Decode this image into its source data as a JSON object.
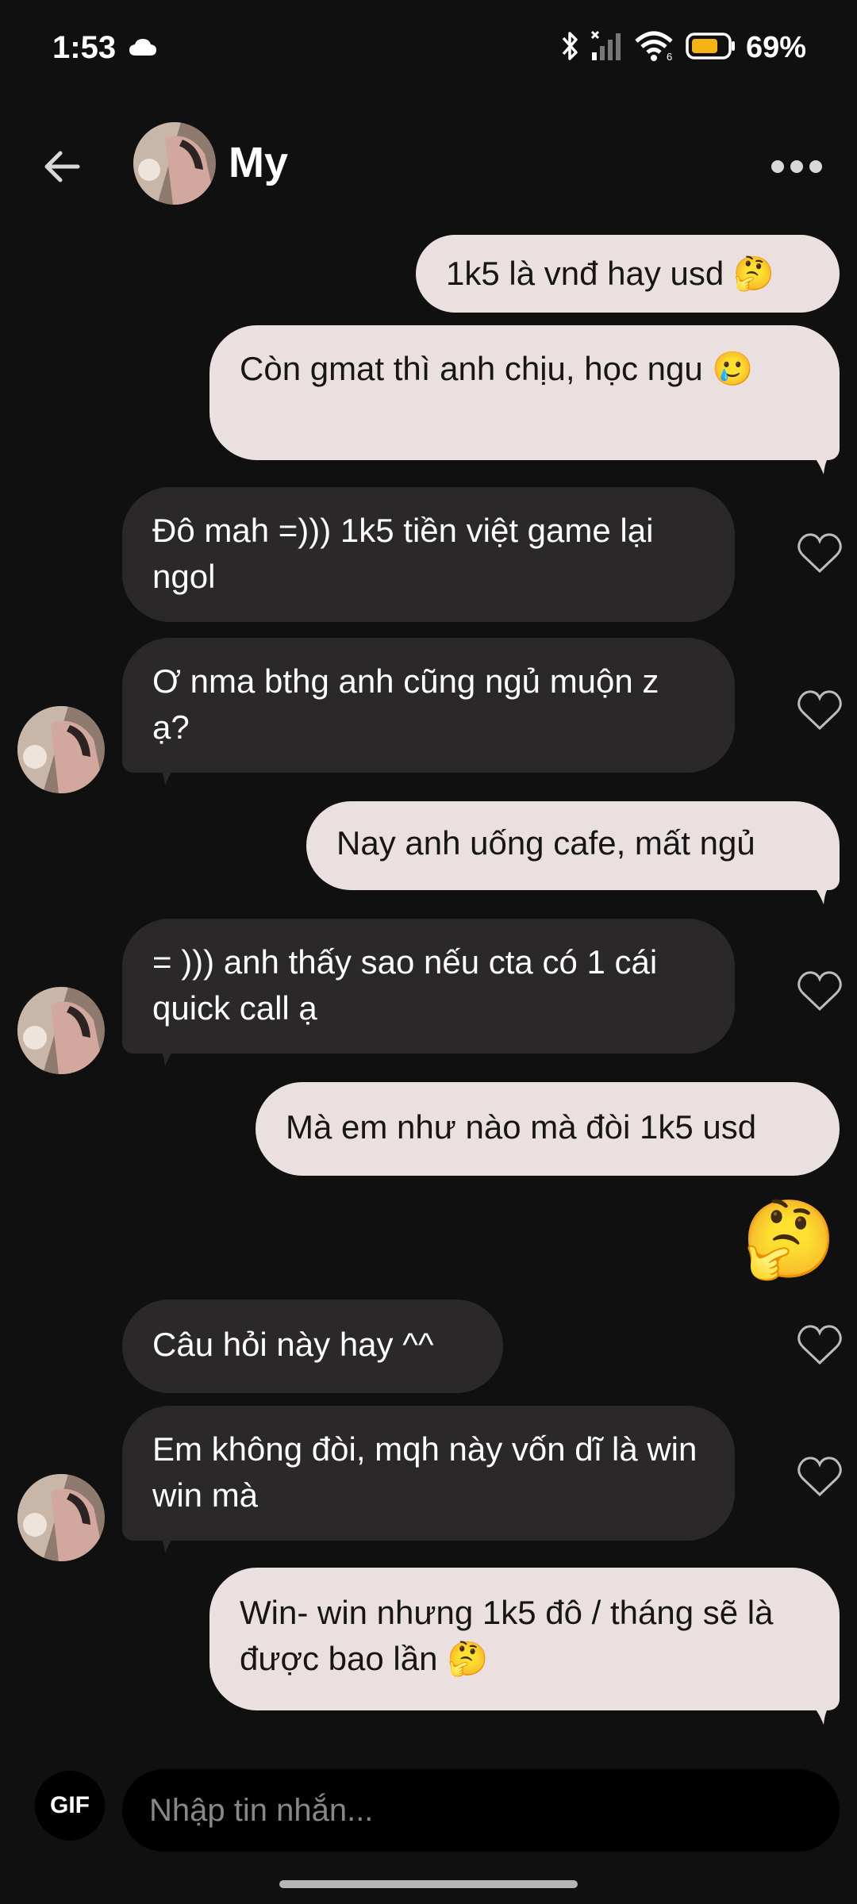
{
  "status_bar": {
    "time": "1:53",
    "battery": "69%"
  },
  "header": {
    "contact_name": "My"
  },
  "messages": [
    {
      "direction": "out",
      "text": "1k5 là vnđ hay usd 🤔"
    },
    {
      "direction": "out",
      "text": "Còn gmat thì anh chịu, học ngu 🥲"
    },
    {
      "direction": "in",
      "text": "Đô mah =))) 1k5 tiền việt game lại ngol"
    },
    {
      "direction": "in",
      "text": "Ơ nma bthg anh cũng ngủ muộn z ạ?"
    },
    {
      "direction": "out",
      "text": "Nay anh uống cafe, mất ngủ"
    },
    {
      "direction": "in",
      "text": "= ))) anh thấy sao nếu cta có 1 cái quick call ạ"
    },
    {
      "direction": "out",
      "text": "Mà em như nào mà đòi 1k5 usd"
    },
    {
      "direction": "out",
      "text": "🤔"
    },
    {
      "direction": "in",
      "text": "Câu hỏi này hay ^^"
    },
    {
      "direction": "in",
      "text": "Em không đòi, mqh này vốn dĩ là win win mà"
    },
    {
      "direction": "out",
      "text": "Win- win nhưng 1k5 đô / tháng sẽ là được bao lần 🤔"
    }
  ],
  "composer": {
    "gif_label": "GIF",
    "placeholder": "Nhập tin nhắn..."
  },
  "colors": {
    "background": "#111010",
    "outgoing_bubble": "#ebe0e0",
    "incoming_bubble": "#2a2828"
  },
  "icons": [
    "cloud-icon",
    "bluetooth-icon",
    "signal-icon",
    "wifi-icon",
    "battery-icon",
    "back-arrow-icon",
    "more-icon",
    "heart-icon"
  ]
}
